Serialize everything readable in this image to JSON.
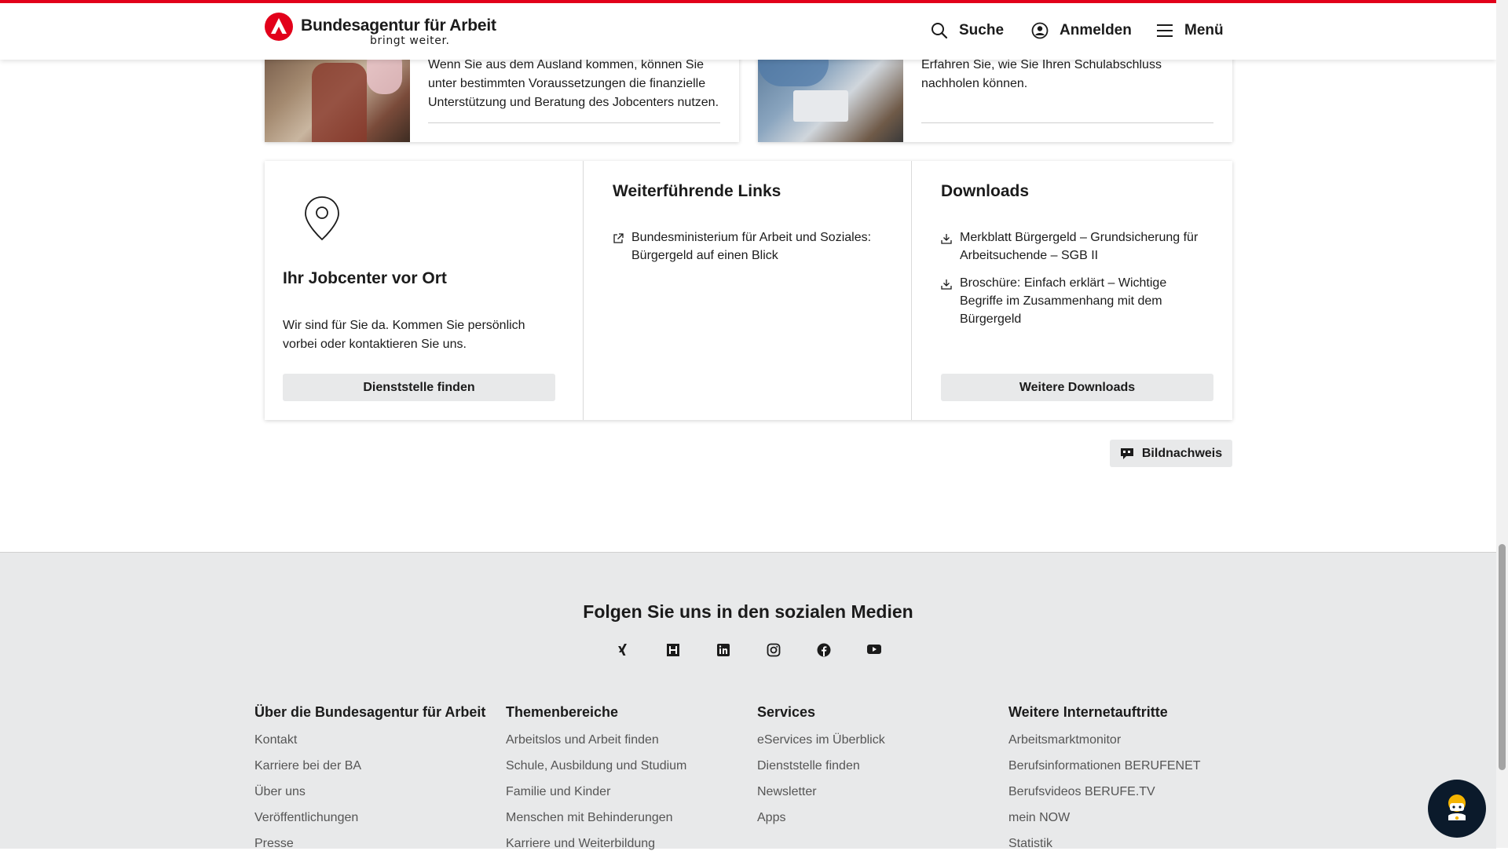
{
  "header": {
    "logo_title": "Bundesagentur für Arbeit",
    "logo_subtitle": "bringt weiter.",
    "search_label": "Suche",
    "login_label": "Anmelden",
    "menu_label": "Menü"
  },
  "cards": [
    {
      "text": "Wenn Sie aus dem Ausland kommen, können Sie unter bestimmten Voraussetzungen die finanzielle Unterstützung und Beratung des Jobcenters nutzen."
    },
    {
      "text": "Erfahren Sie, wie Sie Ihren Schulabschluss nachholen können."
    }
  ],
  "jobcenter": {
    "title": "Ihr Jobcenter vor Ort",
    "text": "Wir sind für Sie da. Kommen Sie persönlich vorbei oder kontaktieren Sie uns.",
    "button": "Dienststelle finden"
  },
  "links": {
    "title": "Weiterführende Links",
    "items": [
      {
        "label": "Bundesministerium für Arbeit und Soziales: Bürgergeld auf einen Blick"
      }
    ]
  },
  "downloads": {
    "title": "Downloads",
    "items": [
      {
        "label": "Merkblatt Bürgergeld – Grundsicherung für Arbeitsuchende – SGB II"
      },
      {
        "label": "Broschüre: Einfach erklärt – Wichtige Begriffe im Zusammenhang mit dem Bürgergeld"
      }
    ],
    "button": "Weitere Downloads"
  },
  "bildnachweis_label": "Bildnachweis",
  "footer": {
    "social_title": "Folgen Sie uns in den sozialen Medien",
    "social_icons": [
      "xing-icon",
      "kununu-icon",
      "linkedin-icon",
      "instagram-icon",
      "facebook-icon",
      "youtube-icon"
    ],
    "columns": [
      {
        "title": "Über die Bundesagentur für Arbeit",
        "links": [
          "Kontakt",
          "Karriere bei der BA",
          "Über uns",
          "Veröffentlichungen",
          "Presse"
        ]
      },
      {
        "title": "Themenbereiche",
        "links": [
          "Arbeitslos und Arbeit finden",
          "Schule, Ausbildung und Studium",
          "Familie und Kinder",
          "Menschen mit Behinderungen",
          "Karriere und Weiterbildung"
        ]
      },
      {
        "title": "Services",
        "links": [
          "eServices im Überblick",
          "Dienststelle finden",
          "Newsletter",
          "Apps"
        ]
      },
      {
        "title": "Weitere Internetauftritte",
        "links": [
          "Arbeitsmarktmonitor",
          "Berufsinformationen BERUFENET",
          "Berufsvideos BERUFE.TV",
          "mein NOW",
          "Statistik"
        ]
      }
    ]
  },
  "colors": {
    "brand_red": "#e2001a",
    "footer_bg": "#e8e9ea",
    "button_bg": "#e8e9ea"
  }
}
